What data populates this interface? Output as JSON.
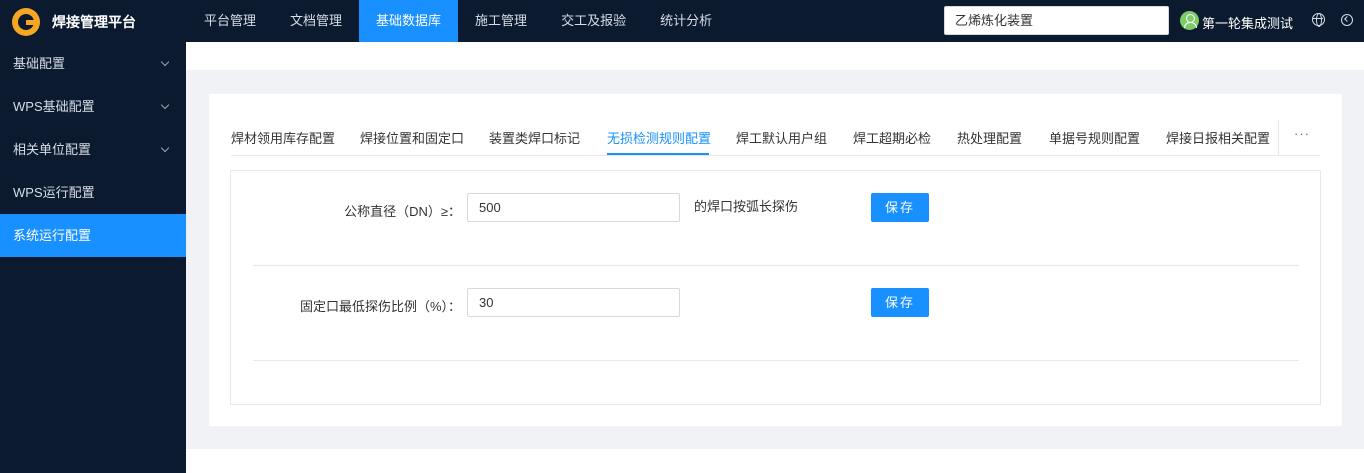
{
  "header": {
    "app_title": "焊接管理平台",
    "nav": [
      {
        "label": "平台管理"
      },
      {
        "label": "文档管理"
      },
      {
        "label": "基础数据库",
        "active": true
      },
      {
        "label": "施工管理"
      },
      {
        "label": "交工及报验"
      },
      {
        "label": "统计分析"
      }
    ],
    "project_select": "乙烯炼化装置",
    "user_name": "第一轮集成测试",
    "icons": {
      "avatar": "user-icon",
      "language": "globe-icon",
      "logout": "logout-icon"
    }
  },
  "sidebar": {
    "items": [
      {
        "label": "基础配置",
        "expandable": true
      },
      {
        "label": "WPS基础配置",
        "expandable": true
      },
      {
        "label": "相关单位配置",
        "expandable": true
      },
      {
        "label": "WPS运行配置",
        "expandable": false
      },
      {
        "label": "系统运行配置",
        "active": true
      }
    ]
  },
  "tabs": {
    "items": [
      {
        "label": "焊材领用库存配置"
      },
      {
        "label": "焊接位置和固定口"
      },
      {
        "label": "装置类焊口标记"
      },
      {
        "label": "无损检测规则配置",
        "active": true
      },
      {
        "label": "焊工默认用户组"
      },
      {
        "label": "焊工超期必检"
      },
      {
        "label": "热处理配置"
      },
      {
        "label": "单据号规则配置"
      },
      {
        "label": "焊接日报相关配置"
      }
    ],
    "more": "···"
  },
  "form": {
    "rows": [
      {
        "label": "公称直径（DN）≥：",
        "value": "500",
        "suffix": "的焊口按弧长探伤",
        "save_label": "保存"
      },
      {
        "label": "固定口最低探伤比例（%）：",
        "value": "30",
        "suffix": "",
        "save_label": "保存"
      }
    ]
  },
  "colors": {
    "accent": "#1890ff",
    "nav_bg": "#0b1a2f",
    "logo": "#f5a623"
  }
}
